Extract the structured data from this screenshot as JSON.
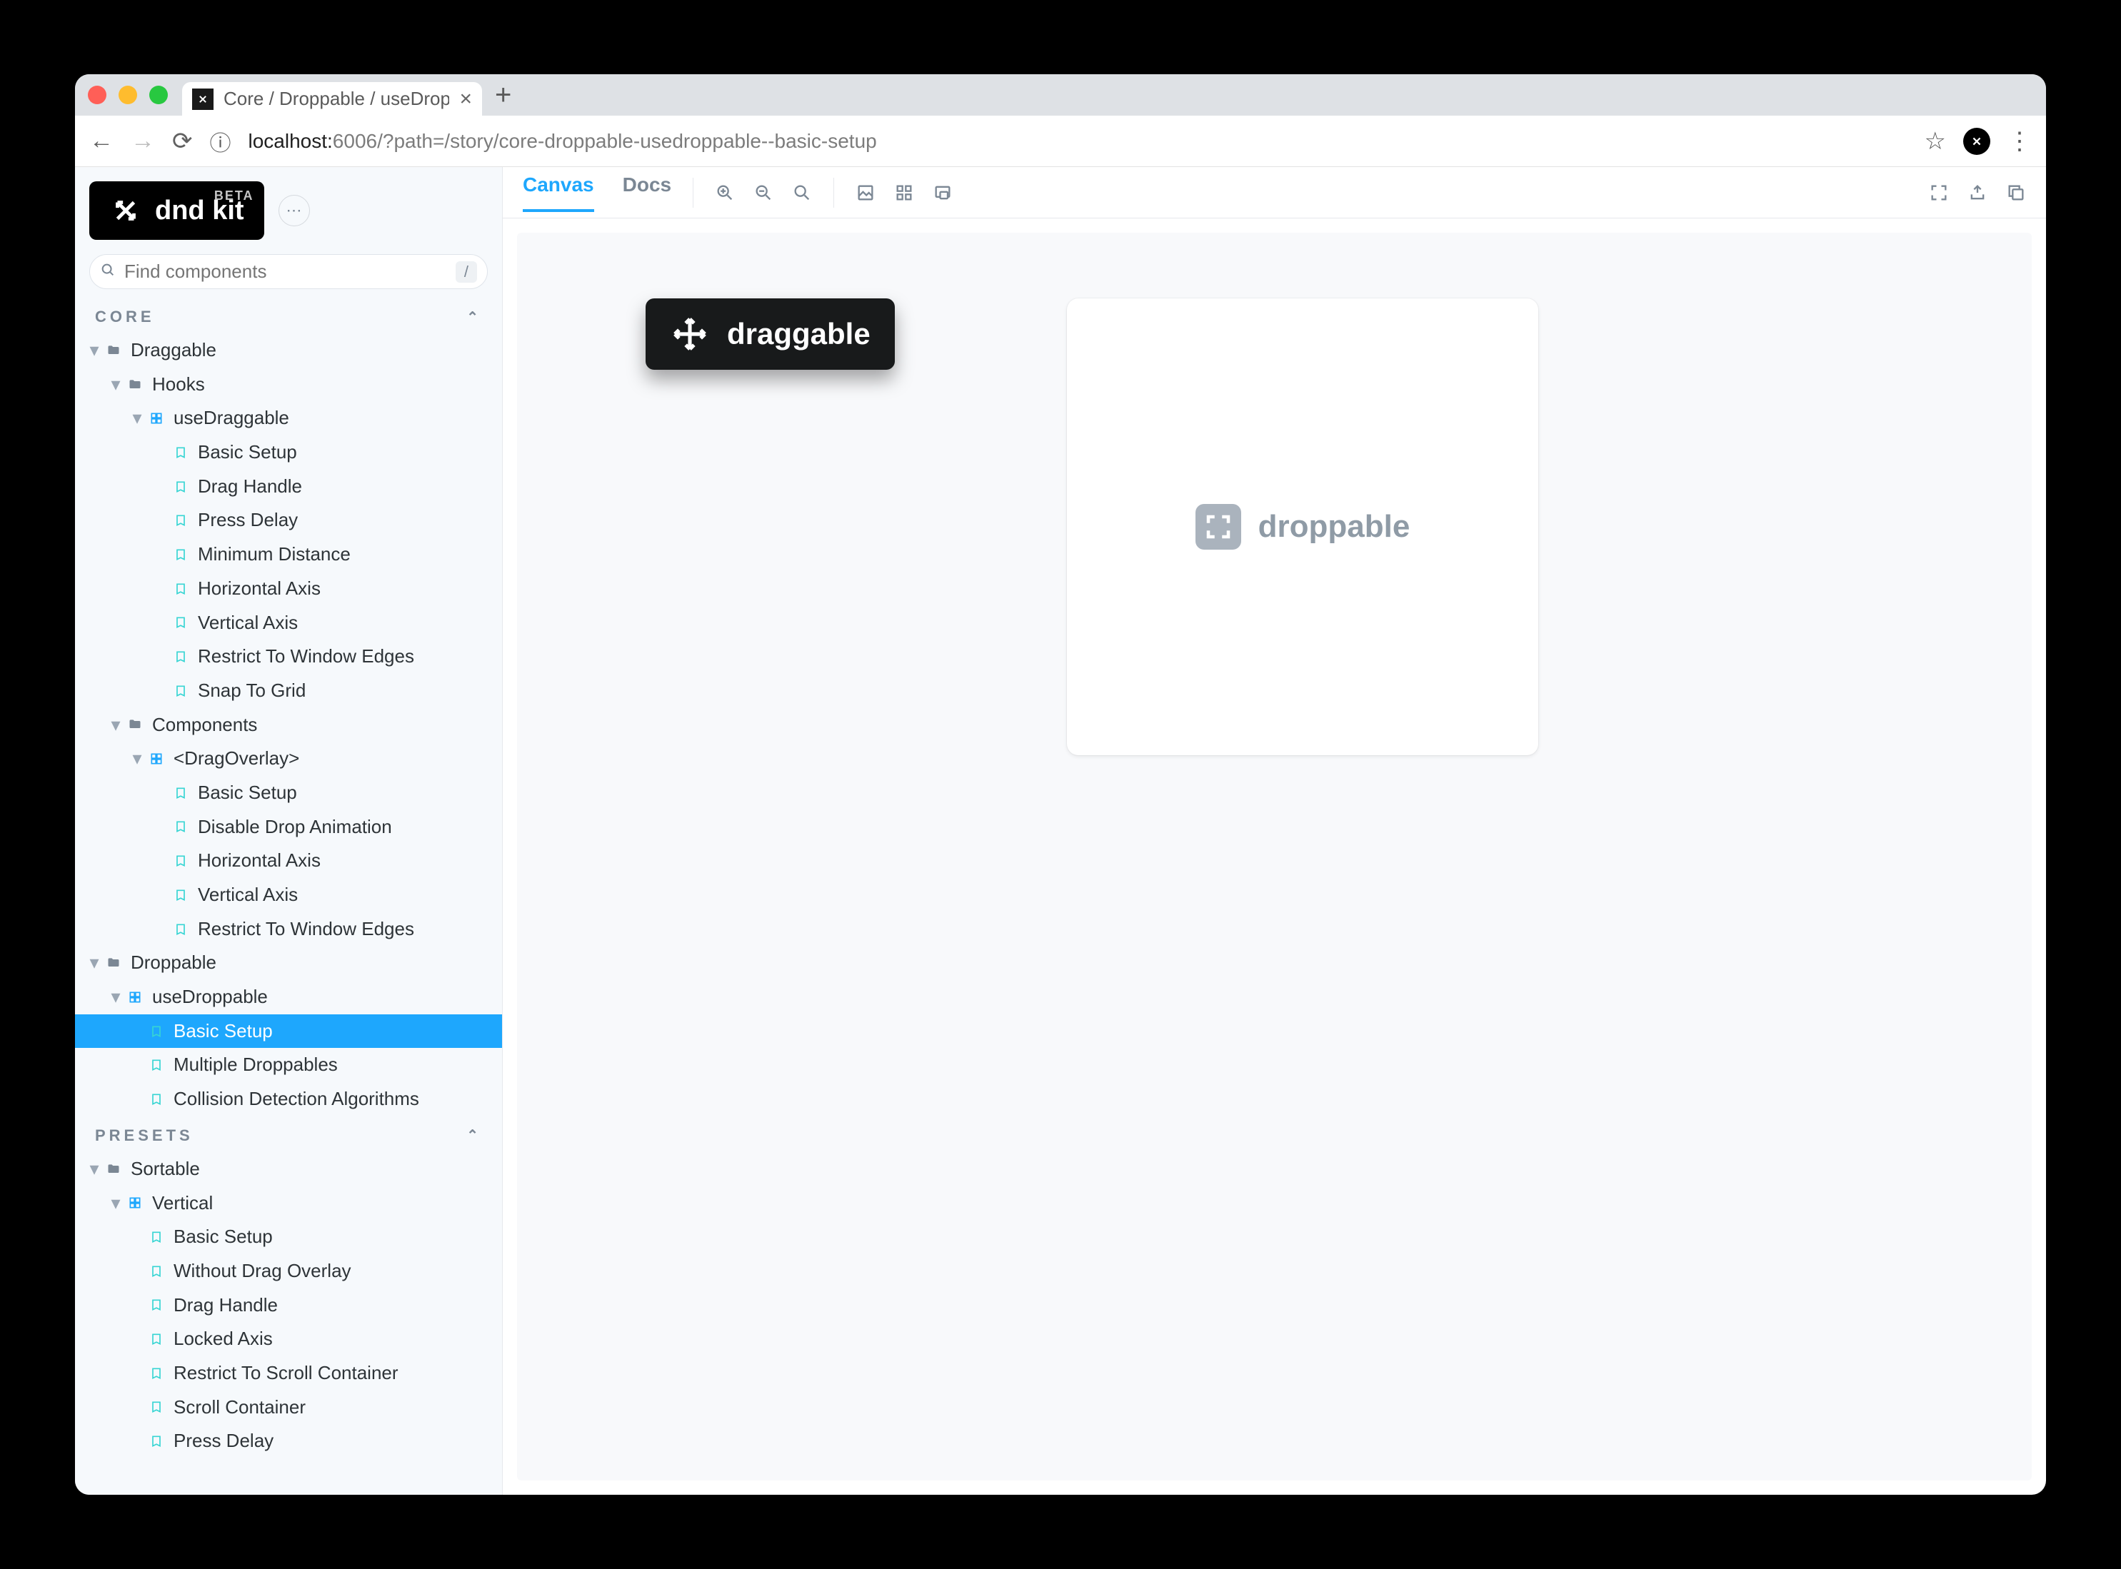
{
  "browser": {
    "tab_title": "Core / Droppable / useDroppal",
    "url_prefix": "localhost:",
    "url_port": "6006",
    "url_path": "/?path=/story/core-droppable-usedroppable--basic-setup"
  },
  "sidebar": {
    "logo_text": "dnd kit",
    "beta": "BETA",
    "search_placeholder": "Find components",
    "search_shortcut": "/",
    "sections": {
      "core": {
        "label": "CORE",
        "items": [
          {
            "label": "Draggable",
            "type": "folder",
            "depth": 1,
            "caret": "down"
          },
          {
            "label": "Hooks",
            "type": "folder",
            "depth": 2,
            "caret": "down"
          },
          {
            "label": "useDraggable",
            "type": "component",
            "depth": 3,
            "caret": "down"
          },
          {
            "label": "Basic Setup",
            "type": "story",
            "depth": 4
          },
          {
            "label": "Drag Handle",
            "type": "story",
            "depth": 4
          },
          {
            "label": "Press Delay",
            "type": "story",
            "depth": 4
          },
          {
            "label": "Minimum Distance",
            "type": "story",
            "depth": 4
          },
          {
            "label": "Horizontal Axis",
            "type": "story",
            "depth": 4
          },
          {
            "label": "Vertical Axis",
            "type": "story",
            "depth": 4
          },
          {
            "label": "Restrict To Window Edges",
            "type": "story",
            "depth": 4
          },
          {
            "label": "Snap To Grid",
            "type": "story",
            "depth": 4
          },
          {
            "label": "Components",
            "type": "folder",
            "depth": 2,
            "caret": "down"
          },
          {
            "label": "<DragOverlay>",
            "type": "component",
            "depth": 3,
            "caret": "down"
          },
          {
            "label": "Basic Setup",
            "type": "story",
            "depth": 4
          },
          {
            "label": "Disable Drop Animation",
            "type": "story",
            "depth": 4
          },
          {
            "label": "Horizontal Axis",
            "type": "story",
            "depth": 4
          },
          {
            "label": "Vertical Axis",
            "type": "story",
            "depth": 4
          },
          {
            "label": "Restrict To Window Edges",
            "type": "story",
            "depth": 4
          },
          {
            "label": "Droppable",
            "type": "folder",
            "depth": 1,
            "caret": "down"
          },
          {
            "label": "useDroppable",
            "type": "component",
            "depth": 2,
            "caret": "down"
          },
          {
            "label": "Basic Setup",
            "type": "story",
            "depth": 3,
            "selected": true
          },
          {
            "label": "Multiple Droppables",
            "type": "story",
            "depth": 3
          },
          {
            "label": "Collision Detection Algorithms",
            "type": "story",
            "depth": 3
          }
        ]
      },
      "presets": {
        "label": "PRESETS",
        "items": [
          {
            "label": "Sortable",
            "type": "folder",
            "depth": 1,
            "caret": "down"
          },
          {
            "label": "Vertical",
            "type": "component",
            "depth": 2,
            "caret": "down"
          },
          {
            "label": "Basic Setup",
            "type": "story",
            "depth": 3
          },
          {
            "label": "Without Drag Overlay",
            "type": "story",
            "depth": 3
          },
          {
            "label": "Drag Handle",
            "type": "story",
            "depth": 3
          },
          {
            "label": "Locked Axis",
            "type": "story",
            "depth": 3
          },
          {
            "label": "Restrict To Scroll Container",
            "type": "story",
            "depth": 3
          },
          {
            "label": "Scroll Container",
            "type": "story",
            "depth": 3
          },
          {
            "label": "Press Delay",
            "type": "story",
            "depth": 3
          }
        ]
      }
    }
  },
  "story_toolbar": {
    "tabs": [
      "Canvas",
      "Docs"
    ],
    "active_tab": "Canvas"
  },
  "canvas": {
    "draggable_label": "draggable",
    "droppable_label": "droppable"
  }
}
